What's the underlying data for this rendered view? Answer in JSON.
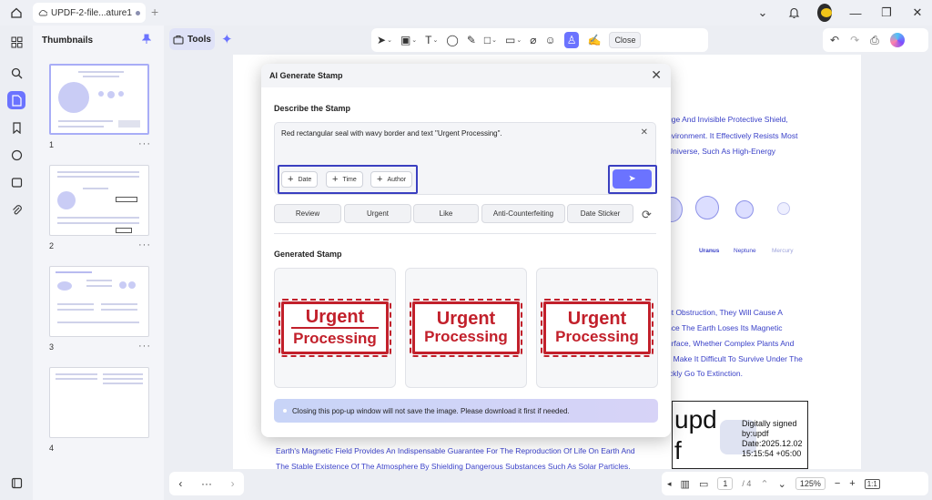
{
  "tab": {
    "title": "UPDF-2-file...ature111(2)"
  },
  "thumbnails": {
    "title": "Thumbnails",
    "pages": [
      {
        "num": "1",
        "more": "···"
      },
      {
        "num": "2",
        "more": "···"
      },
      {
        "num": "3",
        "more": "···"
      },
      {
        "num": "4",
        "more": "···"
      }
    ]
  },
  "toolbar": {
    "tools_label": "Tools",
    "close_label": "Close"
  },
  "document": {
    "lines_top": [
      "uge And Invisible Protective Shield,",
      "nvironment. It Effectively Resists Most",
      "Universe, Such As High-Energy"
    ],
    "planet_labels": [
      "n",
      "Uranus",
      "Neptune",
      "Mercury"
    ],
    "lines_mid": [
      "ut Obstruction, They Will Cause A",
      "nce The Earth Loses Its Magnetic",
      "urface, Whether Complex Plants And",
      "s Make It Difficult To Survive Under The",
      "ickly Go To Extinction."
    ],
    "lines_bottom": [
      "Earth's Magnetic Field Provides An Indispensable Guarantee For The Reproduction Of Life On Earth And",
      "The Stable Existence Of The Atmosphere By Shielding Dangerous Substances Such As Solar Particles."
    ],
    "signature": {
      "big1": "upd",
      "big2": "f",
      "lines": [
        "Digitally signed",
        "by:updf",
        "Date:2025.12.02",
        "15:15:54 +05:00"
      ]
    }
  },
  "footer": {
    "page_current": "1",
    "page_total": "/ 4",
    "zoom": "125%",
    "more": "···"
  },
  "modal": {
    "title": "AI Generate Stamp",
    "describe_title": "Describe the Stamp",
    "description": "Red rectangular seal with wavy border and text \"Urgent Processing\".",
    "chips": [
      {
        "label": "Date"
      },
      {
        "label": "Time"
      },
      {
        "label": "Author"
      }
    ],
    "presets": [
      "Review",
      "Urgent",
      "Like",
      "Anti-Counterfeiting",
      "Date Sticker"
    ],
    "generated_title": "Generated Stamp",
    "stamps": [
      {
        "line1": "Urgent",
        "line2": "Processing"
      },
      {
        "line1": "Urgent",
        "line2": "Processing"
      },
      {
        "line1": "Urgent",
        "line2": "Processing"
      }
    ],
    "notice": "Closing this pop-up window will not save the image. Please download it first if needed."
  },
  "colors": {
    "accent": "#6b73ff",
    "highlight_outline": "#3a3fc0",
    "stamp_red": "#c2202b",
    "doc_text_blue": "#3a41c8"
  }
}
